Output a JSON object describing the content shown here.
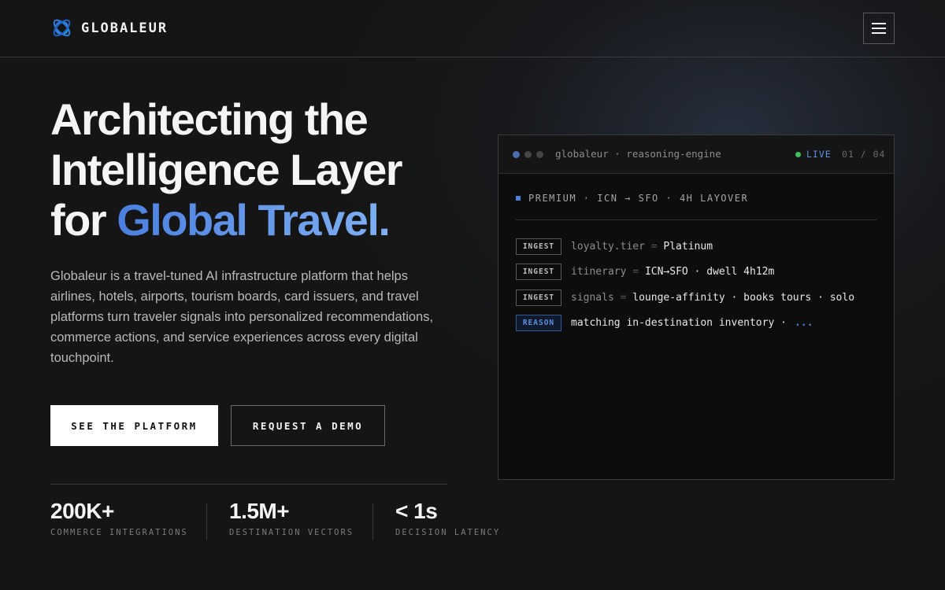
{
  "brand": {
    "name": "GLOBALEUR",
    "colors": {
      "accent": "#4a7fe0",
      "accent_light": "#7fb0f2",
      "live": "#3fbf5f",
      "background": "#151515"
    }
  },
  "header": {
    "menu_icon": "hamburger-icon"
  },
  "hero": {
    "title_line1": "Architecting the",
    "title_line2": "Intelligence Layer",
    "title_line3_prefix": "for ",
    "title_line3_accent": "Global Travel.",
    "description": "Globaleur is a travel-tuned AI infrastructure platform that helps airlines, hotels, airports, tourism boards, card issuers, and travel platforms turn traveler signals into personalized recommendations, commerce actions, and service experiences across every digital touchpoint.",
    "primary_cta": "SEE THE PLATFORM",
    "secondary_cta": "REQUEST A DEMO"
  },
  "stats": [
    {
      "value": "200K+",
      "label": "COMMERCE INTEGRATIONS"
    },
    {
      "value": "1.5M+",
      "label": "DESTINATION VECTORS"
    },
    {
      "value": "< 1s",
      "label": "DECISION LATENCY"
    }
  ],
  "terminal": {
    "title": "globaleur · reasoning-engine",
    "live_label": "LIVE",
    "page_count": "01 / 04",
    "section_tag": "PREMIUM · ICN → SFO · 4H LAYOVER",
    "logs": [
      {
        "badge": "INGEST",
        "key": "loyalty.tier",
        "eq": "=",
        "value": "Platinum"
      },
      {
        "badge": "INGEST",
        "key": "itinerary",
        "eq": "=",
        "value": "ICN→SFO · dwell 4h12m"
      },
      {
        "badge": "INGEST",
        "key": "signals",
        "eq": "=",
        "value": "lounge-affinity · books tours · solo"
      },
      {
        "badge": "REASON",
        "text": "matching in-destination inventory ·",
        "dots": "..."
      }
    ]
  }
}
